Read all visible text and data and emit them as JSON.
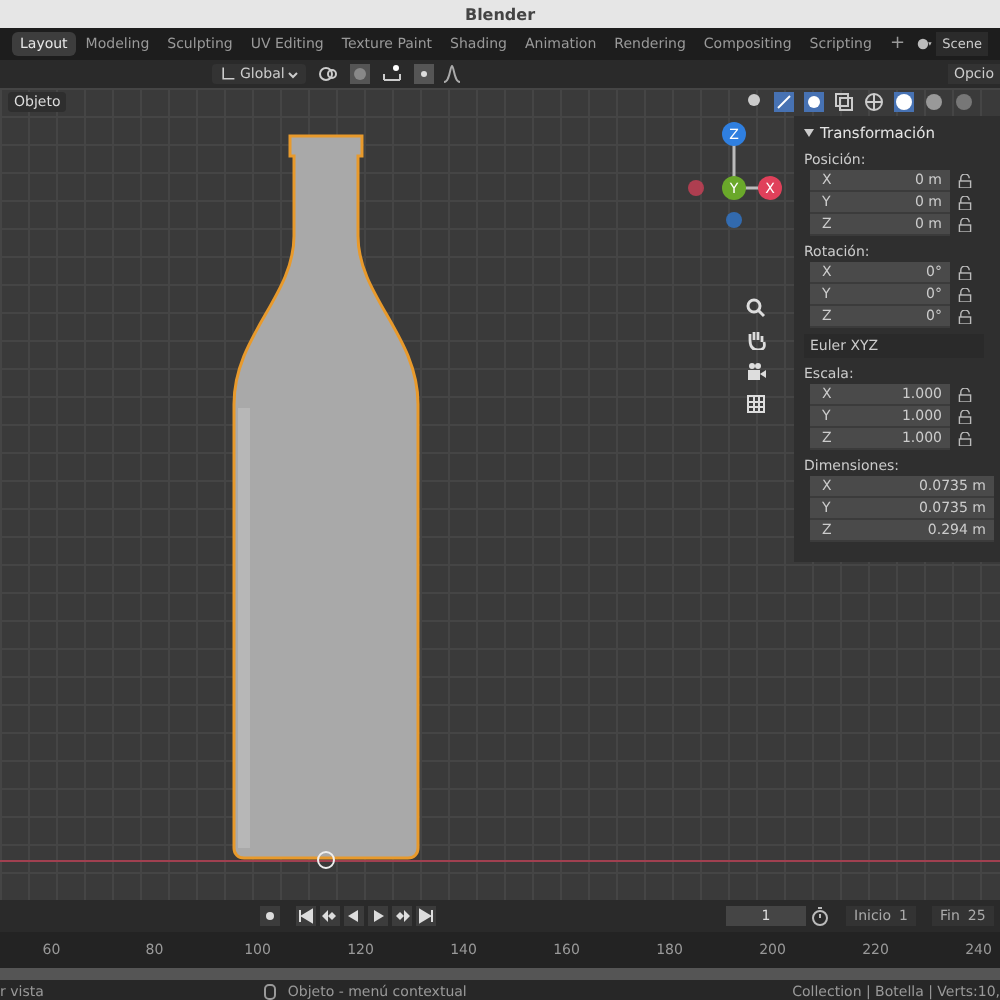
{
  "window": {
    "title": "Blender"
  },
  "workspace_tabs": [
    {
      "label": "Layout",
      "selected": true
    },
    {
      "label": "Modeling",
      "selected": false
    },
    {
      "label": "Sculpting",
      "selected": false
    },
    {
      "label": "UV Editing",
      "selected": false
    },
    {
      "label": "Texture Paint",
      "selected": false
    },
    {
      "label": "Shading",
      "selected": false
    },
    {
      "label": "Animation",
      "selected": false
    },
    {
      "label": "Rendering",
      "selected": false
    },
    {
      "label": "Compositing",
      "selected": false
    },
    {
      "label": "Scripting",
      "selected": false
    }
  ],
  "add_tab": "+",
  "scene_field": "Scene",
  "header": {
    "orientation": "Global",
    "options_button": "Opcio"
  },
  "viewport": {
    "mode_label": "Objeto",
    "gizmo": [
      {
        "axis": "Z",
        "color": "#2f7fe0"
      },
      {
        "axis": "Y",
        "color": "#6aa82a"
      },
      {
        "axis": "X",
        "color": "#e0405a"
      }
    ],
    "panel": {
      "title": "Transformación",
      "expanded": true,
      "groups": [
        {
          "label": "Posición:",
          "locks": true,
          "fields": [
            {
              "axis": "X",
              "value": "0 m"
            },
            {
              "axis": "Y",
              "value": "0 m"
            },
            {
              "axis": "Z",
              "value": "0 m"
            }
          ]
        },
        {
          "label": "Rotación:",
          "locks": true,
          "fields": [
            {
              "axis": "X",
              "value": "0°"
            },
            {
              "axis": "Y",
              "value": "0°"
            },
            {
              "axis": "Z",
              "value": "0°"
            }
          ],
          "mode": "Euler XYZ"
        },
        {
          "label": "Escala:",
          "locks": true,
          "fields": [
            {
              "axis": "X",
              "value": "1.000"
            },
            {
              "axis": "Y",
              "value": "1.000"
            },
            {
              "axis": "Z",
              "value": "1.000"
            }
          ]
        },
        {
          "label": "Dimensiones:",
          "locks": false,
          "fields": [
            {
              "axis": "X",
              "value": "0.0735 m"
            },
            {
              "axis": "Y",
              "value": "0.0735 m"
            },
            {
              "axis": "Z",
              "value": "0.294 m"
            }
          ]
        }
      ]
    }
  },
  "timeline": {
    "current_frame": "1",
    "start_label": "Inicio",
    "start_value": "1",
    "end_label": "Fin",
    "end_value": "25",
    "ruler": [
      "60",
      "80",
      "100",
      "120",
      "140",
      "160",
      "180",
      "200",
      "220",
      "240"
    ]
  },
  "status_bar": {
    "left": "r vista",
    "context": "Objeto - menú contextual",
    "stats": "Collection | Botella | Verts:10,"
  }
}
